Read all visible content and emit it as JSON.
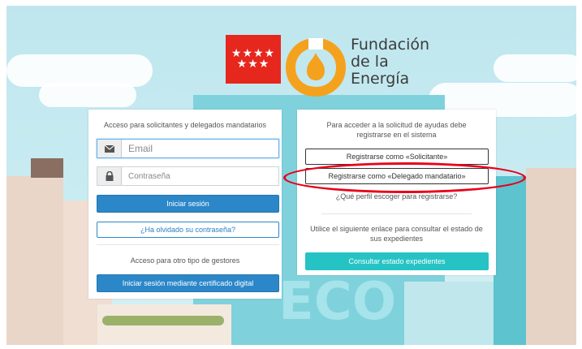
{
  "brand": {
    "flag_stars": "★★★★\n★★★",
    "name_lines": [
      "Fundación",
      "de la",
      "Energía"
    ],
    "colors": {
      "flag_red": "#e5271d",
      "mark_orange": "#f4a21d"
    }
  },
  "login": {
    "title": "Acceso para solicitantes y delegados mandatarios",
    "email": {
      "placeholder": "Email",
      "value": "",
      "icon": "envelope-icon"
    },
    "password": {
      "placeholder": "Contraseña",
      "value": "",
      "icon": "lock-icon"
    },
    "login_button": "Iniciar sesión",
    "forgot_button": "¿Ha olvidado su contraseña?",
    "other_title": "Acceso para otro tipo de gestores",
    "certificate_button": "Iniciar sesión mediante certificado digital"
  },
  "register": {
    "title": "Para acceder a la solicitud de ayudas debe registrarse en el sistema",
    "applicant_button": "Registrarse como «Solicitante»",
    "delegate_button": "Registrarse como «Delegado mandatario»",
    "profile_link": "¿Qué perfil escoger para registrarse?",
    "status_text": "Utilice el siguiente enlace para consultar el estado de sus expedientes",
    "status_button": "Consultar estado expedientes"
  },
  "background": {
    "building_sign": "ECO"
  },
  "colors": {
    "primary": "#2b87c8",
    "teal": "#26c3c4",
    "annotation_red": "#e8001a"
  }
}
